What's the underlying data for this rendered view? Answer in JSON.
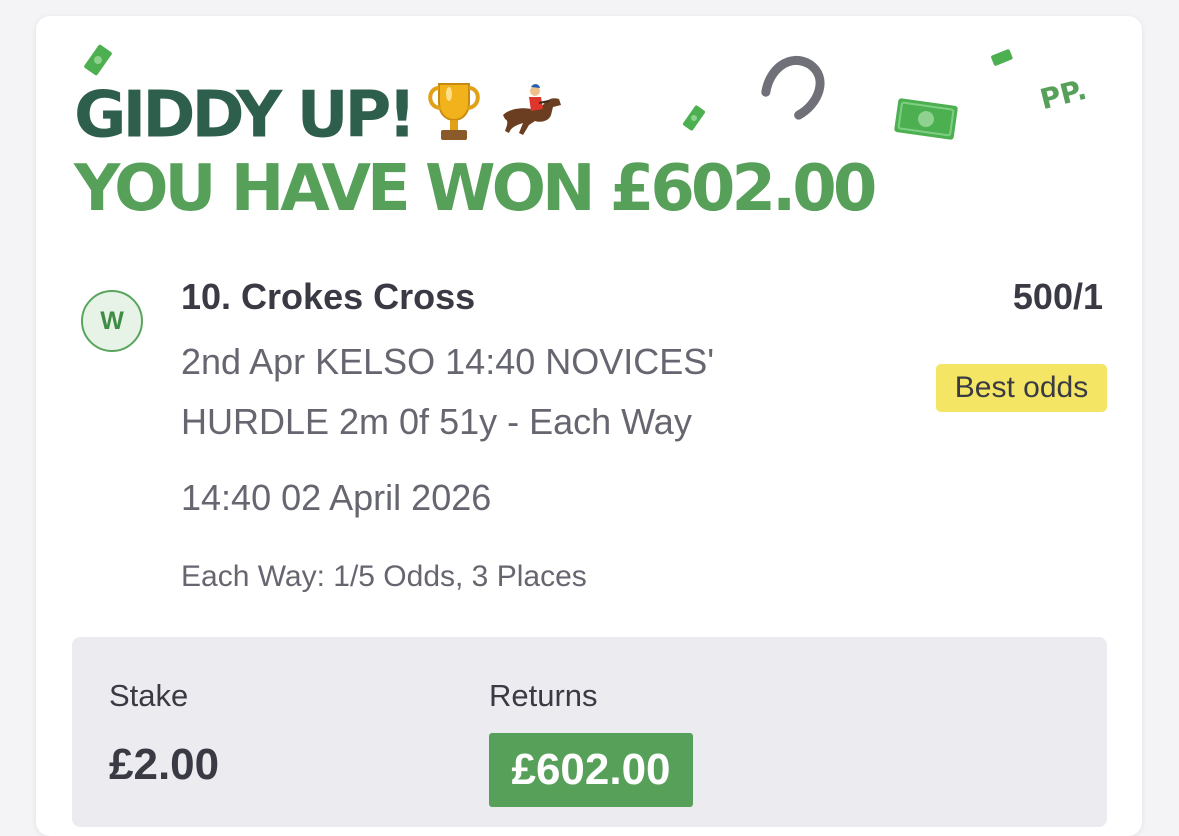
{
  "banner": {
    "headline": "GIDDY UP!",
    "win_message": "YOU HAVE WON £602.00",
    "pp_logo": "PP."
  },
  "icons": {
    "trophy": "trophy-icon",
    "horse_racing": "horse-racing-icon",
    "horseshoe": "horseshoe-icon",
    "money": "money-note-icon"
  },
  "selection": {
    "result_badge": "W",
    "name": "10. Crokes Cross",
    "odds": "500/1",
    "event": "2nd Apr KELSO 14:40 NOVICES' HURDLE 2m 0f 51y - Each Way",
    "best_odds_label": "Best odds",
    "time": "14:40 02 April 2026",
    "each_way_terms": "Each Way: 1/5 Odds, 3 Places"
  },
  "bet": {
    "stake_label": "Stake",
    "stake": "£2.00",
    "returns_label": "Returns",
    "returns": "£602.00"
  },
  "colors": {
    "dark_green": "#2e5f4c",
    "brand_green": "#57a05a",
    "best_odds_yellow": "#f4e664",
    "text_dark": "#3a3a44",
    "text_muted": "#666670"
  }
}
